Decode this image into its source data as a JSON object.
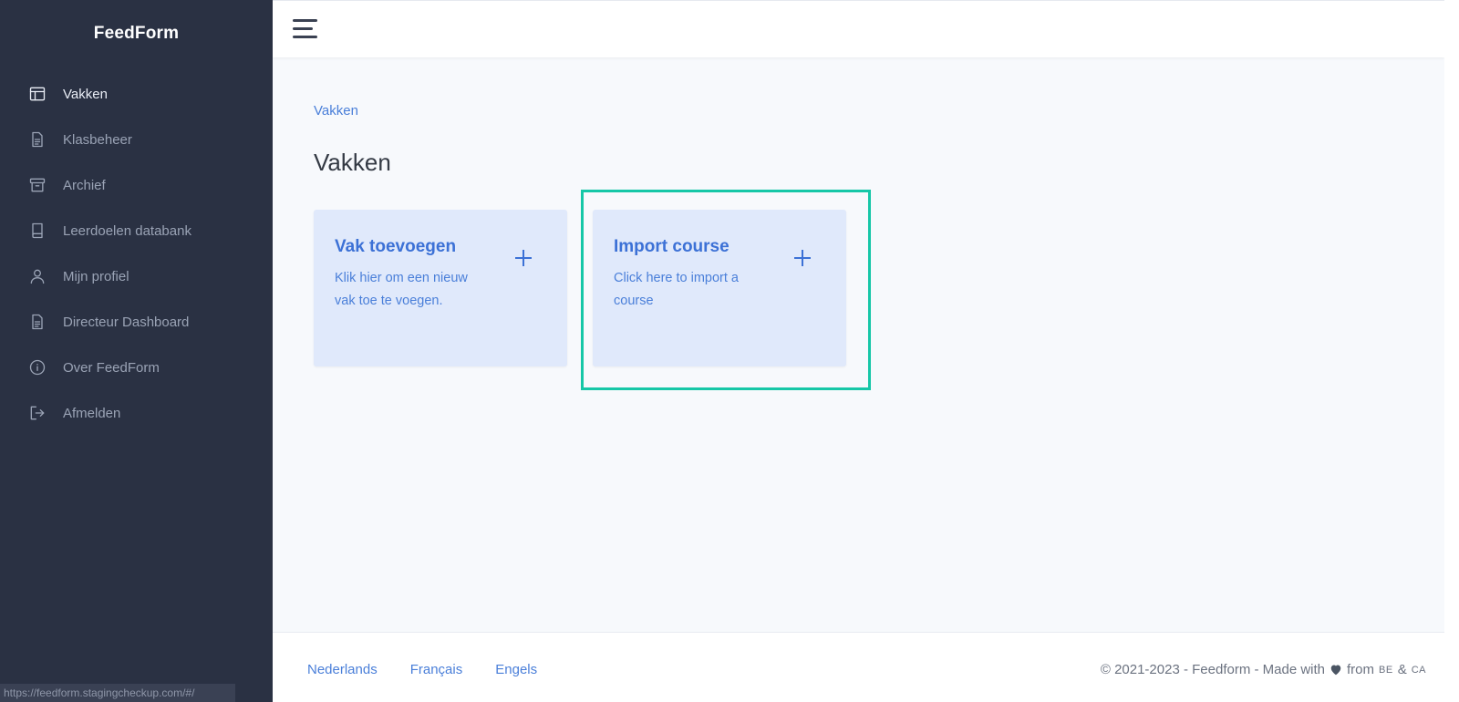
{
  "app": {
    "brand": "FeedForm"
  },
  "sidebar": {
    "items": [
      {
        "label": "Vakken",
        "icon": "layout-icon",
        "active": true
      },
      {
        "label": "Klasbeheer",
        "icon": "document-icon",
        "active": false
      },
      {
        "label": "Archief",
        "icon": "archive-icon",
        "active": false
      },
      {
        "label": "Leerdoelen databank",
        "icon": "book-icon",
        "active": false
      },
      {
        "label": "Mijn profiel",
        "icon": "user-icon",
        "active": false
      },
      {
        "label": "Directeur Dashboard",
        "icon": "document-icon",
        "active": false
      },
      {
        "label": "Over FeedForm",
        "icon": "info-icon",
        "active": false
      },
      {
        "label": "Afmelden",
        "icon": "logout-icon",
        "active": false
      }
    ]
  },
  "status_bar": {
    "url": "https://feedform.stagingcheckup.com/#/"
  },
  "main": {
    "breadcrumb": "Vakken",
    "title": "Vakken",
    "cards": [
      {
        "title": "Vak toevoegen",
        "description": "Klik hier om een nieuw vak toe te voegen.",
        "icon": "plus-icon"
      },
      {
        "title": "Import course",
        "description": "Click here to import a course",
        "icon": "plus-icon"
      }
    ]
  },
  "footer": {
    "languages": [
      "Nederlands",
      "Français",
      "Engels"
    ],
    "copyright_prefix": "© 2021-2023 - Feedform - Made with",
    "copyright_from": "from",
    "country_1": "BE",
    "ampersand": "&",
    "country_2": "CA"
  },
  "colors": {
    "sidebar_bg": "#2a3143",
    "accent": "#3c71d6",
    "card_bg": "#e0e9fb",
    "highlight": "#16c7a7"
  }
}
